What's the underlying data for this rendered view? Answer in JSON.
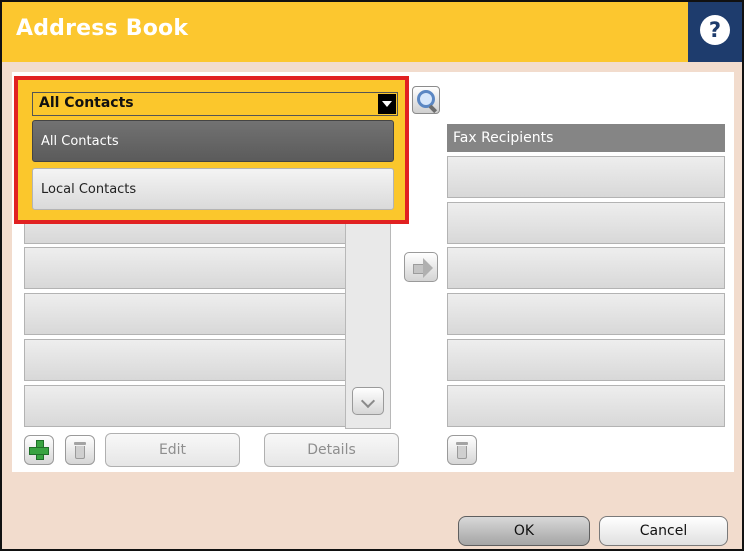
{
  "window": {
    "title": "Address Book",
    "help_icon": "help-icon",
    "help_glyph": "?"
  },
  "contacts_dropdown": {
    "selected": "All Contacts",
    "options": [
      {
        "label": "All Contacts",
        "state": "highlighted"
      },
      {
        "label": "Local Contacts",
        "state": "normal"
      }
    ]
  },
  "fax_recipients": {
    "header": "Fax Recipients"
  },
  "toolbar": {
    "edit_label": "Edit",
    "details_label": "Details"
  },
  "footer": {
    "ok_label": "OK",
    "cancel_label": "Cancel"
  },
  "colors": {
    "title_bar": "#fcc72f",
    "help_button": "#1e3c6d",
    "background": "#f2dccd",
    "dropdown_highlight": "#e12121"
  }
}
